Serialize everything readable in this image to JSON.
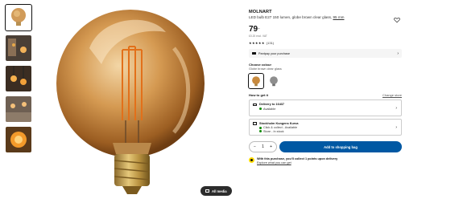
{
  "media": {
    "thumbnails": [
      {
        "name": "thumb-globe-bulb",
        "active": true
      },
      {
        "name": "thumb-lifestyle-1",
        "active": false
      },
      {
        "name": "thumb-lifestyle-2",
        "active": false
      },
      {
        "name": "thumb-lifestyle-3",
        "active": false
      },
      {
        "name": "thumb-lifestyle-4",
        "active": false
      }
    ],
    "all_media_label": "All media"
  },
  "product": {
    "brand": "MOLNART",
    "description": "LED bulb E27 150 lumen, globe brown clear glass,",
    "size_link": "95 mm",
    "price_main": "79",
    "price_sup": ".-",
    "unit_price": "£0.20 excl. VAT",
    "stars": "★★★★★",
    "review_count": "(131)"
  },
  "payment": {
    "label": "Pantpay your purchase"
  },
  "colour": {
    "title": "Choose colour",
    "value": "Globe brown clear glass",
    "swatches": [
      "brown-bulb",
      "grey-bulb"
    ]
  },
  "get_it": {
    "title": "How to get it",
    "change_store": "Change store",
    "delivery_title": "Delivery to 16437",
    "delivery_status": "Available",
    "store_title": "Stockholm Kungens Kurva",
    "store_line1": "Click & collect - Available",
    "store_line2": "Store - In stock"
  },
  "buy": {
    "minus": "−",
    "quantity": "1",
    "plus": "+",
    "add_label": "Add to shopping bag"
  },
  "points": {
    "line1": "With this purchase, you'll collect 1 points upon delivery",
    "line2": "Explore what you can get"
  },
  "colors": {
    "brand_blue": "#0058a3",
    "available_green": "#0a8a00",
    "points_yellow": "#ffdb00"
  }
}
